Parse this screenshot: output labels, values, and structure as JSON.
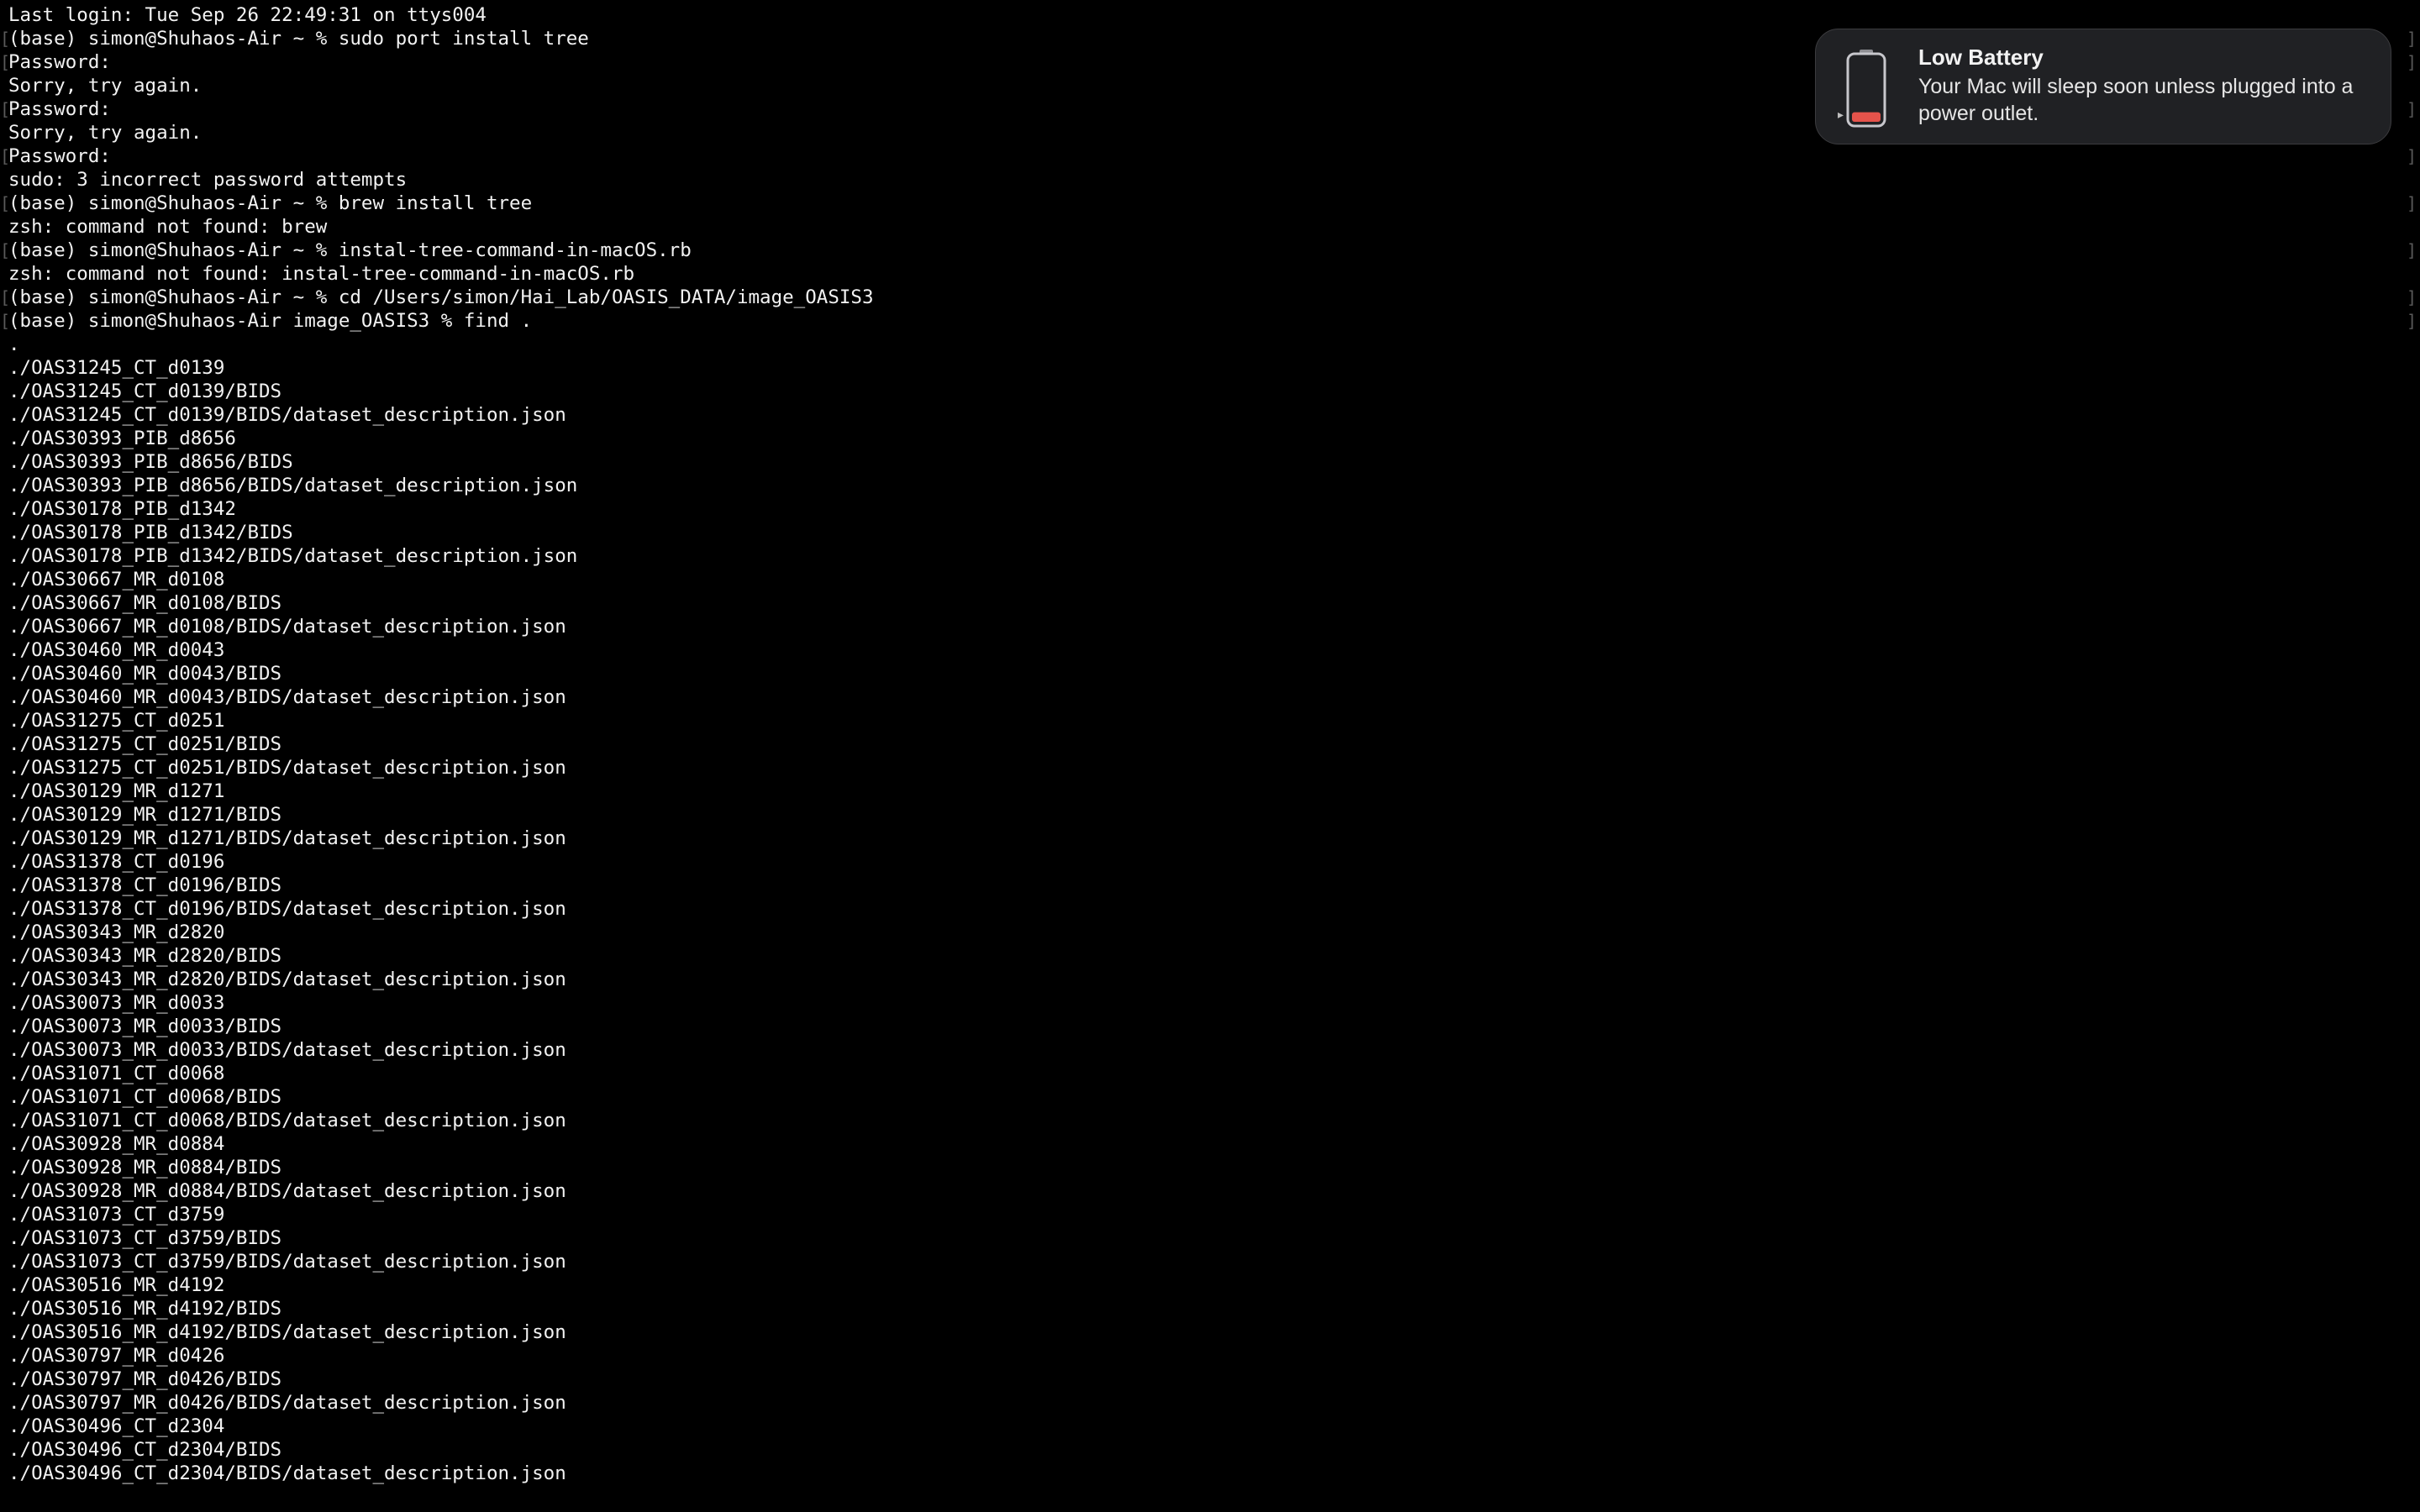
{
  "terminal": {
    "lines": [
      "Last login: Tue Sep 26 22:49:31 on ttys004",
      "(base) simon@Shuhaos-Air ~ % sudo port install tree",
      "Password:",
      "Sorry, try again.",
      "Password:",
      "Sorry, try again.",
      "Password:",
      "sudo: 3 incorrect password attempts",
      "(base) simon@Shuhaos-Air ~ % brew install tree",
      "zsh: command not found: brew",
      "(base) simon@Shuhaos-Air ~ % instal-tree-command-in-macOS.rb",
      "zsh: command not found: instal-tree-command-in-macOS.rb",
      "(base) simon@Shuhaos-Air ~ % cd /Users/simon/Hai_Lab/OASIS_DATA/image_OASIS3",
      "(base) simon@Shuhaos-Air image_OASIS3 % find .",
      ".",
      "./OAS31245_CT_d0139",
      "./OAS31245_CT_d0139/BIDS",
      "./OAS31245_CT_d0139/BIDS/dataset_description.json",
      "./OAS30393_PIB_d8656",
      "./OAS30393_PIB_d8656/BIDS",
      "./OAS30393_PIB_d8656/BIDS/dataset_description.json",
      "./OAS30178_PIB_d1342",
      "./OAS30178_PIB_d1342/BIDS",
      "./OAS30178_PIB_d1342/BIDS/dataset_description.json",
      "./OAS30667_MR_d0108",
      "./OAS30667_MR_d0108/BIDS",
      "./OAS30667_MR_d0108/BIDS/dataset_description.json",
      "./OAS30460_MR_d0043",
      "./OAS30460_MR_d0043/BIDS",
      "./OAS30460_MR_d0043/BIDS/dataset_description.json",
      "./OAS31275_CT_d0251",
      "./OAS31275_CT_d0251/BIDS",
      "./OAS31275_CT_d0251/BIDS/dataset_description.json",
      "./OAS30129_MR_d1271",
      "./OAS30129_MR_d1271/BIDS",
      "./OAS30129_MR_d1271/BIDS/dataset_description.json",
      "./OAS31378_CT_d0196",
      "./OAS31378_CT_d0196/BIDS",
      "./OAS31378_CT_d0196/BIDS/dataset_description.json",
      "./OAS30343_MR_d2820",
      "./OAS30343_MR_d2820/BIDS",
      "./OAS30343_MR_d2820/BIDS/dataset_description.json",
      "./OAS30073_MR_d0033",
      "./OAS30073_MR_d0033/BIDS",
      "./OAS30073_MR_d0033/BIDS/dataset_description.json",
      "./OAS31071_CT_d0068",
      "./OAS31071_CT_d0068/BIDS",
      "./OAS31071_CT_d0068/BIDS/dataset_description.json",
      "./OAS30928_MR_d0884",
      "./OAS30928_MR_d0884/BIDS",
      "./OAS30928_MR_d0884/BIDS/dataset_description.json",
      "./OAS31073_CT_d3759",
      "./OAS31073_CT_d3759/BIDS",
      "./OAS31073_CT_d3759/BIDS/dataset_description.json",
      "./OAS30516_MR_d4192",
      "./OAS30516_MR_d4192/BIDS",
      "./OAS30516_MR_d4192/BIDS/dataset_description.json",
      "./OAS30797_MR_d0426",
      "./OAS30797_MR_d0426/BIDS",
      "./OAS30797_MR_d0426/BIDS/dataset_description.json",
      "./OAS30496_CT_d2304",
      "./OAS30496_CT_d2304/BIDS",
      "./OAS30496_CT_d2304/BIDS/dataset_description.json"
    ],
    "mark_left": "[",
    "mark_right": "]"
  },
  "notification": {
    "title": "Low Battery",
    "body": "Your Mac will sleep soon unless plugged into a power outlet.",
    "icon": "battery-low-icon",
    "expand_glyph": "▸",
    "battery_level": 0.15,
    "battery_color": "#e5534b"
  },
  "colors": {
    "background": "#000000",
    "text": "#f2f2f2",
    "notification_bg": "#202124"
  }
}
